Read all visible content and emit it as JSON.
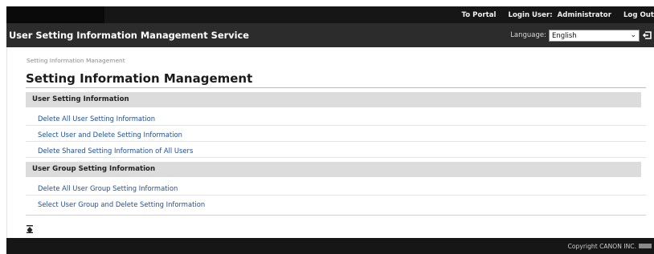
{
  "topbar": {
    "portal_link": "To Portal",
    "login_user_label": "Login User:",
    "login_user_name": "Administrator",
    "logout_link": "Log Out"
  },
  "header": {
    "title": "User Setting Information Management Service",
    "language_label": "Language:",
    "language_value": "English",
    "logout_icon": "logout-arrow-icon"
  },
  "breadcrumb": "Setting Information Management",
  "page_title": "Setting Information Management",
  "sections": [
    {
      "heading": "User Setting Information",
      "links": [
        "Delete All User Setting Information",
        "Select User and Delete Setting Information",
        "Delete Shared Setting Information of All Users"
      ]
    },
    {
      "heading": "User Group Setting Information",
      "links": [
        "Delete All User Group Setting Information",
        "Select User Group and Delete Setting Information"
      ]
    }
  ],
  "back_to_top_icon": "back-to-top-icon",
  "footer": {
    "copyright": "Copyright CANON INC."
  },
  "colors": {
    "header_bg": "#2c2c2c",
    "topbar_bg": "#161616",
    "section_bg": "#dcdcdc",
    "link": "#1f4e9c"
  }
}
